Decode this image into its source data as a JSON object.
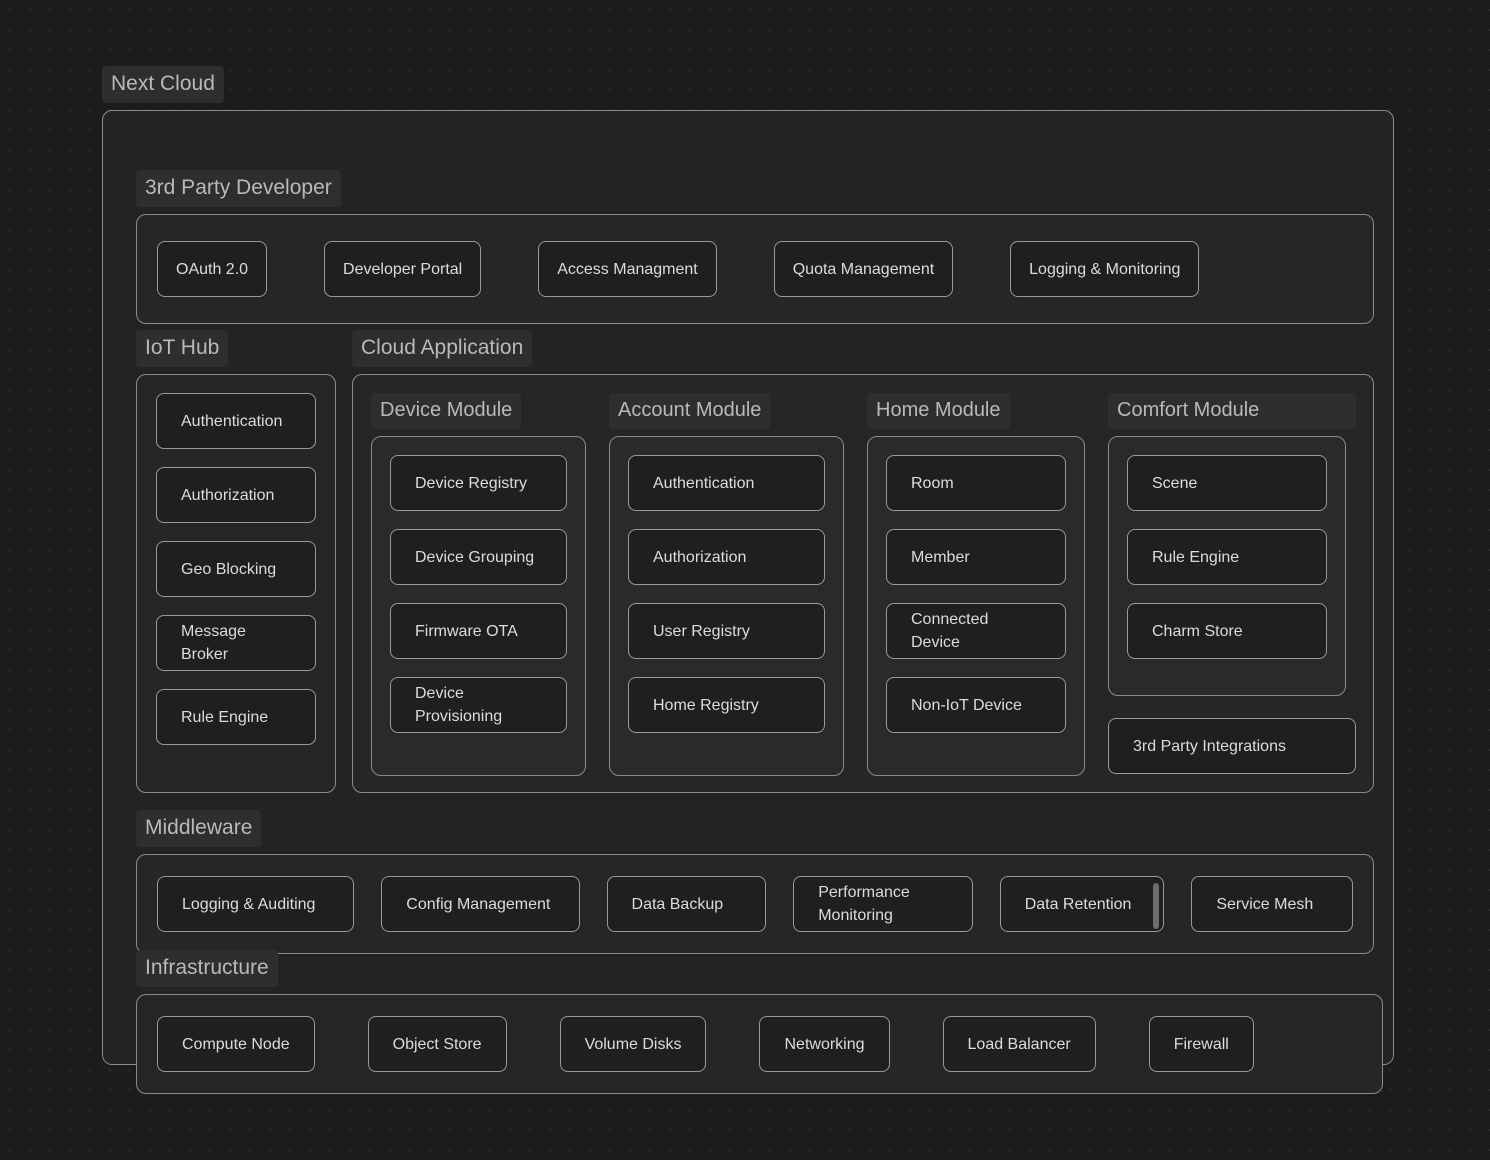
{
  "root": {
    "label": "Next Cloud"
  },
  "third_party_developer": {
    "label": "3rd Party Developer",
    "items": [
      {
        "label": "OAuth 2.0"
      },
      {
        "label": "Developer Portal"
      },
      {
        "label": "Access Managment"
      },
      {
        "label": "Quota Management"
      },
      {
        "label": "Logging & Monitoring"
      }
    ]
  },
  "iot_hub": {
    "label": "IoT Hub",
    "items": [
      {
        "label": "Authentication"
      },
      {
        "label": "Authorization"
      },
      {
        "label": "Geo Blocking"
      },
      {
        "label": "Message Broker"
      },
      {
        "label": "Rule Engine"
      }
    ]
  },
  "cloud_application": {
    "label": "Cloud Application",
    "modules": [
      {
        "label": "Device Module",
        "items": [
          {
            "label": "Device Registry"
          },
          {
            "label": "Device Grouping"
          },
          {
            "label": "Firmware OTA"
          },
          {
            "label": "Device Provisioning"
          }
        ]
      },
      {
        "label": "Account Module",
        "items": [
          {
            "label": "Authentication"
          },
          {
            "label": "Authorization"
          },
          {
            "label": "User Registry"
          },
          {
            "label": "Home Registry"
          }
        ]
      },
      {
        "label": "Home Module",
        "items": [
          {
            "label": "Room"
          },
          {
            "label": "Member"
          },
          {
            "label": "Connected Device"
          },
          {
            "label": "Non-IoT Device"
          }
        ]
      },
      {
        "label": "Comfort Module",
        "items": [
          {
            "label": "Scene"
          },
          {
            "label": "Rule Engine"
          },
          {
            "label": "Charm Store"
          }
        ]
      }
    ],
    "extra_item": {
      "label": "3rd Party Integrations"
    }
  },
  "middleware": {
    "label": "Middleware",
    "items": [
      {
        "label": "Logging & Auditing"
      },
      {
        "label": "Config Management"
      },
      {
        "label": "Data Backup"
      },
      {
        "label": "Performance Monitoring"
      },
      {
        "label": "Data Retention"
      },
      {
        "label": "Service Mesh"
      }
    ]
  },
  "infrastructure": {
    "label": "Infrastructure",
    "items": [
      {
        "label": "Compute Node"
      },
      {
        "label": "Object Store"
      },
      {
        "label": "Volume Disks"
      },
      {
        "label": "Networking"
      },
      {
        "label": "Load Balancer"
      },
      {
        "label": "Firewall"
      }
    ]
  },
  "colors": {
    "page_background": "#1c1c1c",
    "dot_grid": "#343434",
    "container_border": "#8b8b8b",
    "node_border": "#9a9a9a",
    "node_background": "#1f1f1f",
    "label_chip_background": "#2e2e2e",
    "text": "#d9d9d9",
    "scrollbar_thumb": "#6d6d6d"
  }
}
